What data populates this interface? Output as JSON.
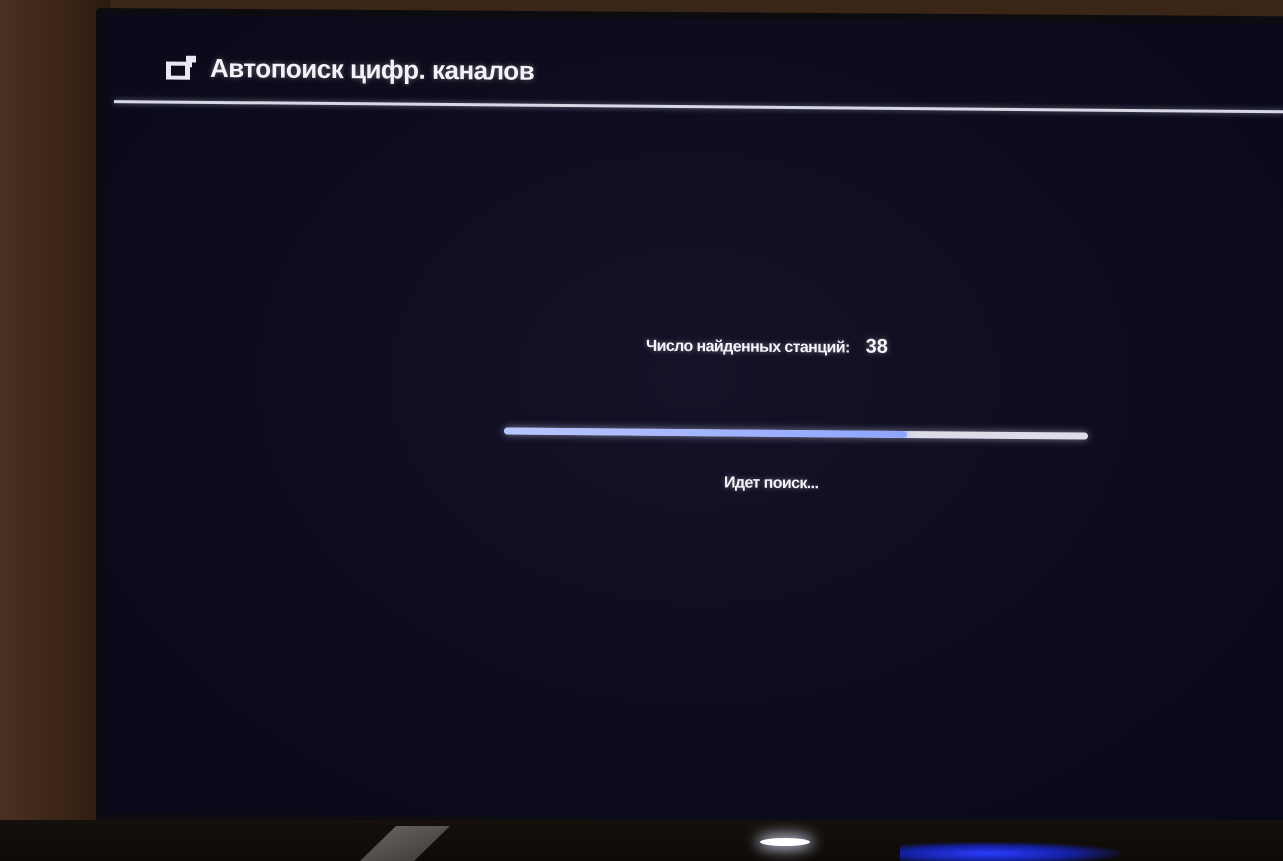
{
  "screen": {
    "title": "Автопоиск цифр. каналов",
    "title_icon": "tv-antenna-icon"
  },
  "search": {
    "stations_label": "Число найденных станций:",
    "stations_count": "38",
    "progress": 0.69,
    "status": "Идет поиск..."
  },
  "colors": {
    "screen_background": "#0d0c1c",
    "text": "#f2f2f7",
    "progress_fill": "#8ea4ff",
    "progress_track": "#dcdce6"
  }
}
